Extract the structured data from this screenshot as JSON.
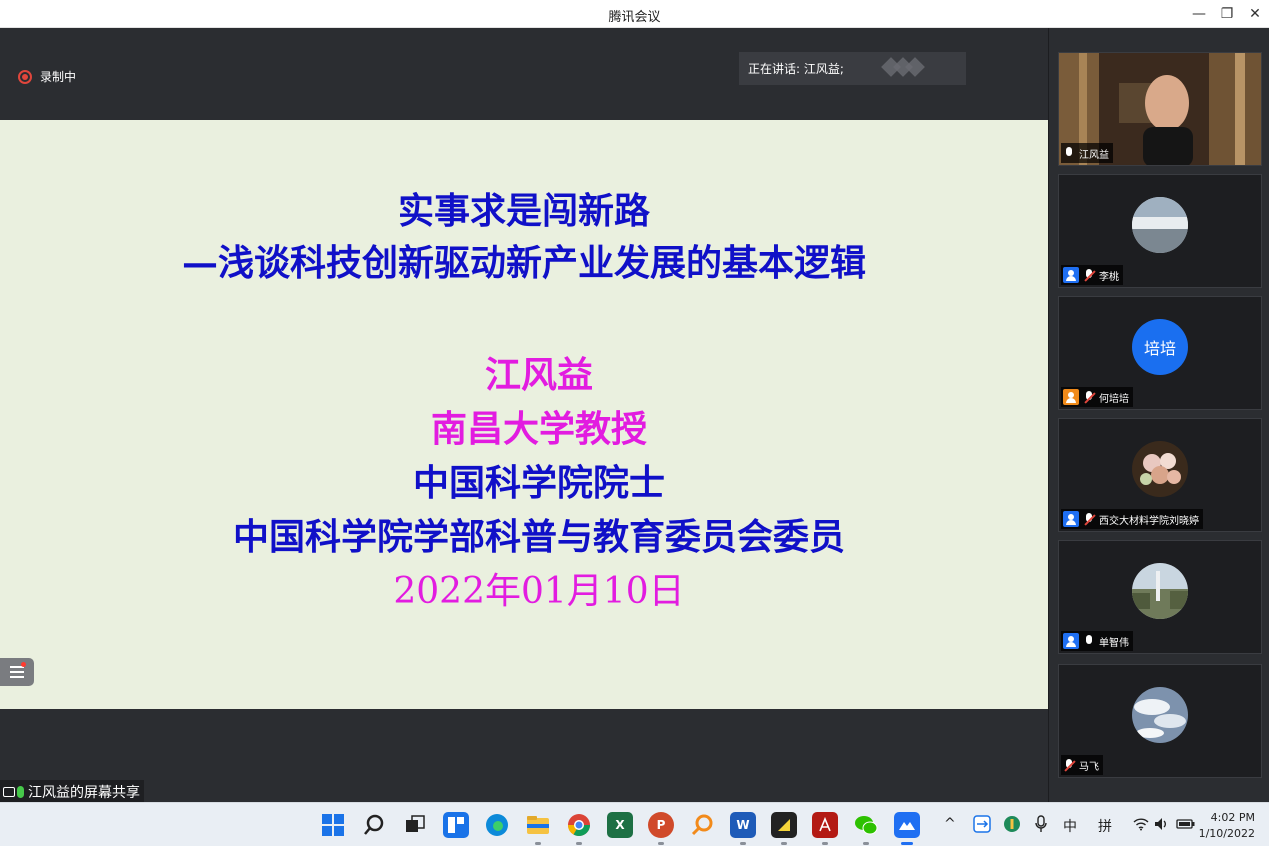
{
  "window": {
    "title": "腾讯会议",
    "minimize": "—",
    "restore": "❐",
    "close": "✕"
  },
  "meeting": {
    "recording_label": "录制中",
    "speaking_label": "正在讲话: 江风益;"
  },
  "slide": {
    "title_line1": "实事求是闯新路",
    "title_line2": "—浅谈科技创新驱动新产业发展的基本逻辑",
    "presenter": "江风益",
    "affiliation1": "南昌大学教授",
    "affiliation2": "中国科学院院士",
    "affiliation3": "中国科学院学部科普与教育委员会委员",
    "date": "2022年01月10日",
    "colors": {
      "blue": "#1010c8",
      "magenta": "#e21ce0",
      "background": "#eaf0df"
    }
  },
  "share_label": "江风益的屏幕共享",
  "participants": [
    {
      "name": "江风益",
      "type": "video",
      "mic": "on"
    },
    {
      "name": "李桃",
      "type": "avatar-photo",
      "mic": "muted",
      "badge": "blue"
    },
    {
      "name": "何培培",
      "type": "avatar-text",
      "avatar_text": "培培",
      "mic": "muted",
      "badge": "orange"
    },
    {
      "name": "西交大材料学院刘晓婷",
      "type": "avatar-photo",
      "mic": "muted",
      "badge": "blue"
    },
    {
      "name": "单智伟",
      "type": "avatar-photo",
      "mic": "on",
      "badge": "blue"
    },
    {
      "name": "马飞",
      "type": "avatar-photo",
      "mic": "muted"
    }
  ],
  "taskbar": {
    "apps": [
      "start-icon",
      "search-icon",
      "task-view-icon",
      "widgets-icon",
      "edge-icon",
      "file-explorer-icon",
      "chrome-icon",
      "excel-icon",
      "powerpoint-icon",
      "search-app-icon",
      "word-icon",
      "sticky-notes-icon",
      "acrobat-icon",
      "wechat-icon",
      "tencent-meeting-icon"
    ],
    "tray": {
      "chevron": "^",
      "ime_lang": "中",
      "ime_mode": "拼"
    },
    "time": "4:02 PM",
    "date": "1/10/2022"
  }
}
